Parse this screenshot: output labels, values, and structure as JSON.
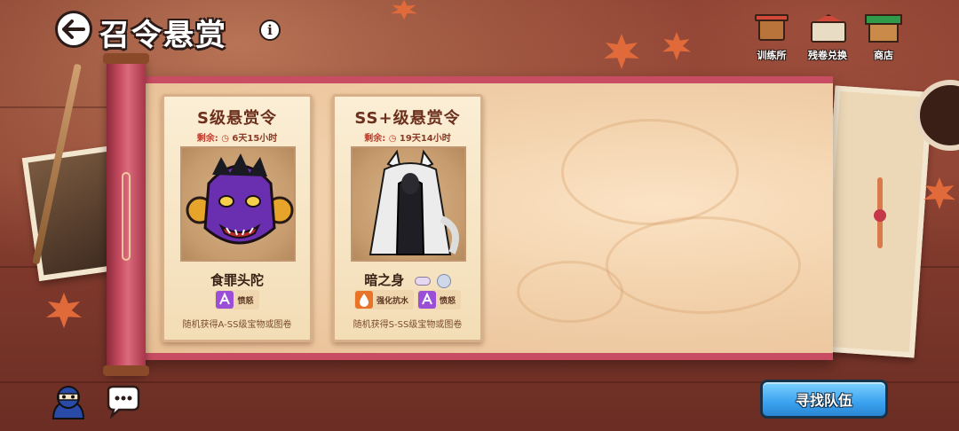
{
  "header": {
    "title": "召令悬赏",
    "info_label": "i"
  },
  "top_buttons": [
    {
      "label": "训练所",
      "icon": "training-hall-icon"
    },
    {
      "label": "残卷兑换",
      "icon": "fragment-exchange-icon"
    },
    {
      "label": "商店",
      "icon": "shop-icon"
    }
  ],
  "cards": [
    {
      "title": "S级悬赏令",
      "remain_label": "剩余:",
      "remain_time": "6天15小时",
      "boss_name": "食罪头陀",
      "tags": [
        {
          "label": "愤怒",
          "icon": "rage-buff-icon",
          "color": "#9b4fd6"
        }
      ],
      "description": "随机获得A-SS级宝物或图卷"
    },
    {
      "title": "SS+级悬赏令",
      "remain_label": "剩余:",
      "remain_time": "19天14小时",
      "boss_name": "暗之身",
      "tags": [
        {
          "label": "强化抗水",
          "icon": "water-resist-icon",
          "color": "#e8742a"
        },
        {
          "label": "愤怒",
          "icon": "rage-buff-icon",
          "color": "#9b4fd6"
        }
      ],
      "description": "随机获得S-SS级宝物或图卷"
    }
  ],
  "bottom": {
    "search_team_label": "寻找队伍",
    "icons": [
      "ninja-avatar-icon",
      "chat-icon"
    ]
  },
  "colors": {
    "scroll_red": "#c94d62",
    "paper": "#f2d1ab",
    "button_blue": "#3aa2ef",
    "timer_red": "#c03a2a"
  }
}
